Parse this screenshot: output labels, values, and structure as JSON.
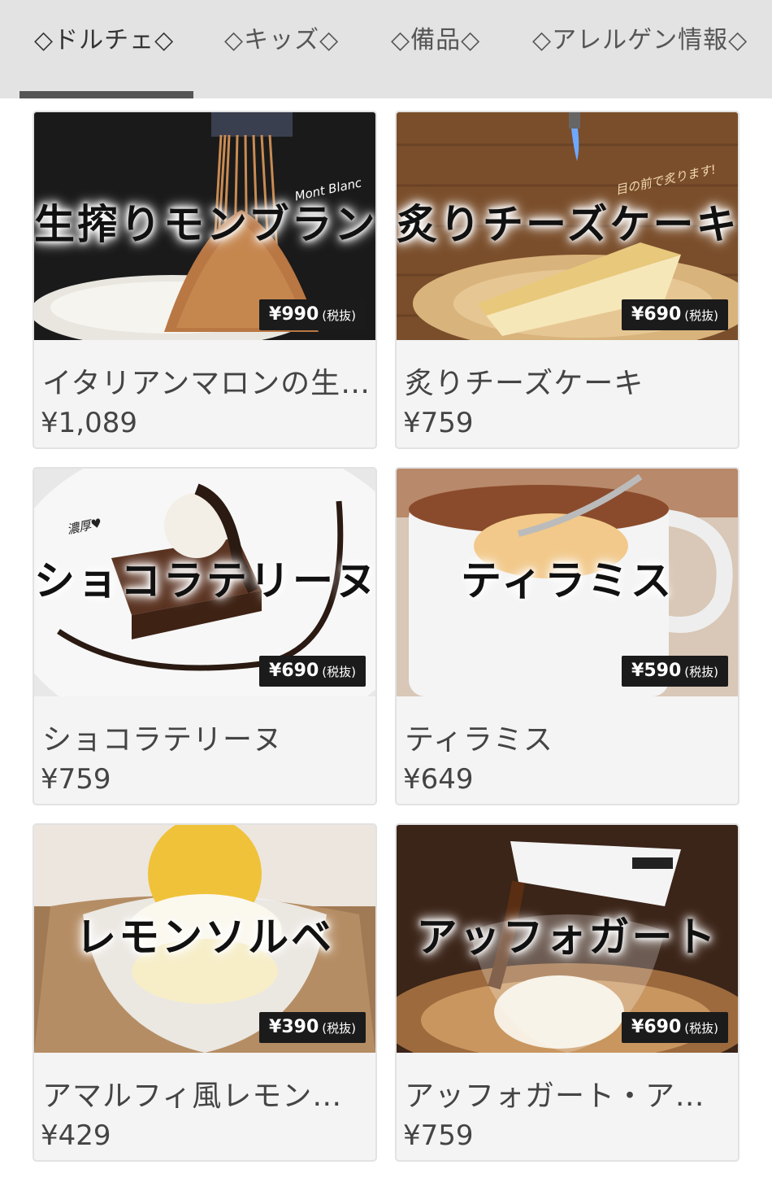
{
  "tabs": [
    {
      "label": "◇ドルチェ◇",
      "active": true
    },
    {
      "label": "◇キッズ◇",
      "active": false
    },
    {
      "label": "◇備品◇",
      "active": false
    },
    {
      "label": "◇アレルゲン情報◇",
      "active": false
    }
  ],
  "items": [
    {
      "overlay": "生搾りモンブラン",
      "badge_price": "¥990",
      "badge_tax": "(税抜)",
      "name": "イタリアンマロンの生搾りモンブラン",
      "price": "¥1,089",
      "note": "Mont Blanc"
    },
    {
      "overlay": "炙りチーズケーキ",
      "badge_price": "¥690",
      "badge_tax": "(税抜)",
      "name": "炙りチーズケーキ",
      "price": "¥759",
      "note": "目の前で炙ります!"
    },
    {
      "overlay": "ショコラテリーヌ",
      "badge_price": "¥690",
      "badge_tax": "(税抜)",
      "name": "ショコラテリーヌ",
      "price": "¥759",
      "note": "濃厚♥"
    },
    {
      "overlay": "ティラミス",
      "badge_price": "¥590",
      "badge_tax": "(税抜)",
      "name": "ティラミス",
      "price": "¥649",
      "note": ""
    },
    {
      "overlay": "レモンソルベ",
      "badge_price": "¥390",
      "badge_tax": "(税抜)",
      "name": "アマルフィ風レモンソルベ",
      "price": "¥429",
      "note": ""
    },
    {
      "overlay": "アッフォガート",
      "badge_price": "¥690",
      "badge_tax": "(税抜)",
      "name": "アッフォガート・アル・カフェ",
      "price": "¥759",
      "note": ""
    }
  ],
  "colors": {
    "tabbar_bg": "#e3e3e3",
    "indicator": "#555555",
    "card_bg": "#f4f4f4",
    "badge_bg": "#1b1b1b"
  }
}
